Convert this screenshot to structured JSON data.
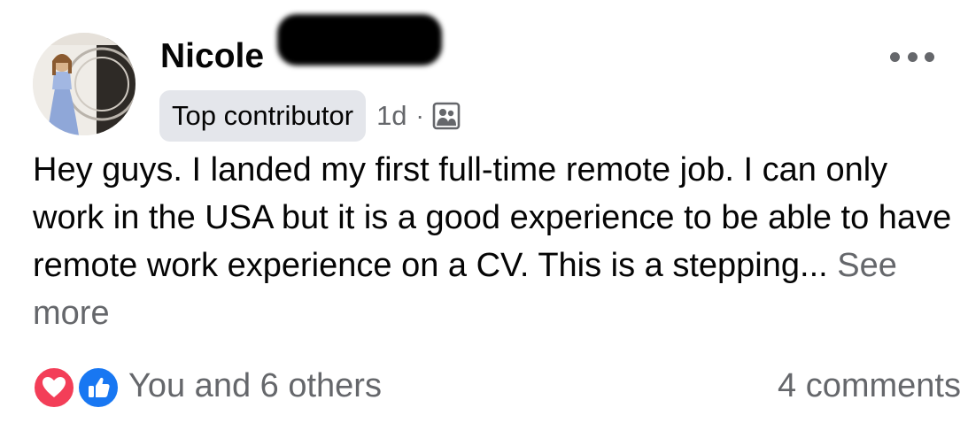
{
  "post": {
    "author": {
      "name": "Nicole",
      "badge": "Top contributor"
    },
    "timestamp": "1d",
    "separator": "·",
    "audience_icon": "group-members-icon",
    "more_icon": "more-options-icon",
    "text": "Hey guys. I landed my first full-time remote job. I can only work in the USA but it is a good experience to be able to have remote work experience on a CV.  This is a stepping...",
    "see_more_label": "See more",
    "reactions": {
      "icons": [
        "love-reaction-icon",
        "like-reaction-icon"
      ],
      "summary": "You and 6 others"
    },
    "comments_label": "4 comments"
  },
  "colors": {
    "primary_text": "#050505",
    "secondary_text": "#65676b",
    "badge_bg": "#e4e6eb",
    "love": "#f33e58",
    "like": "#1877f2"
  }
}
